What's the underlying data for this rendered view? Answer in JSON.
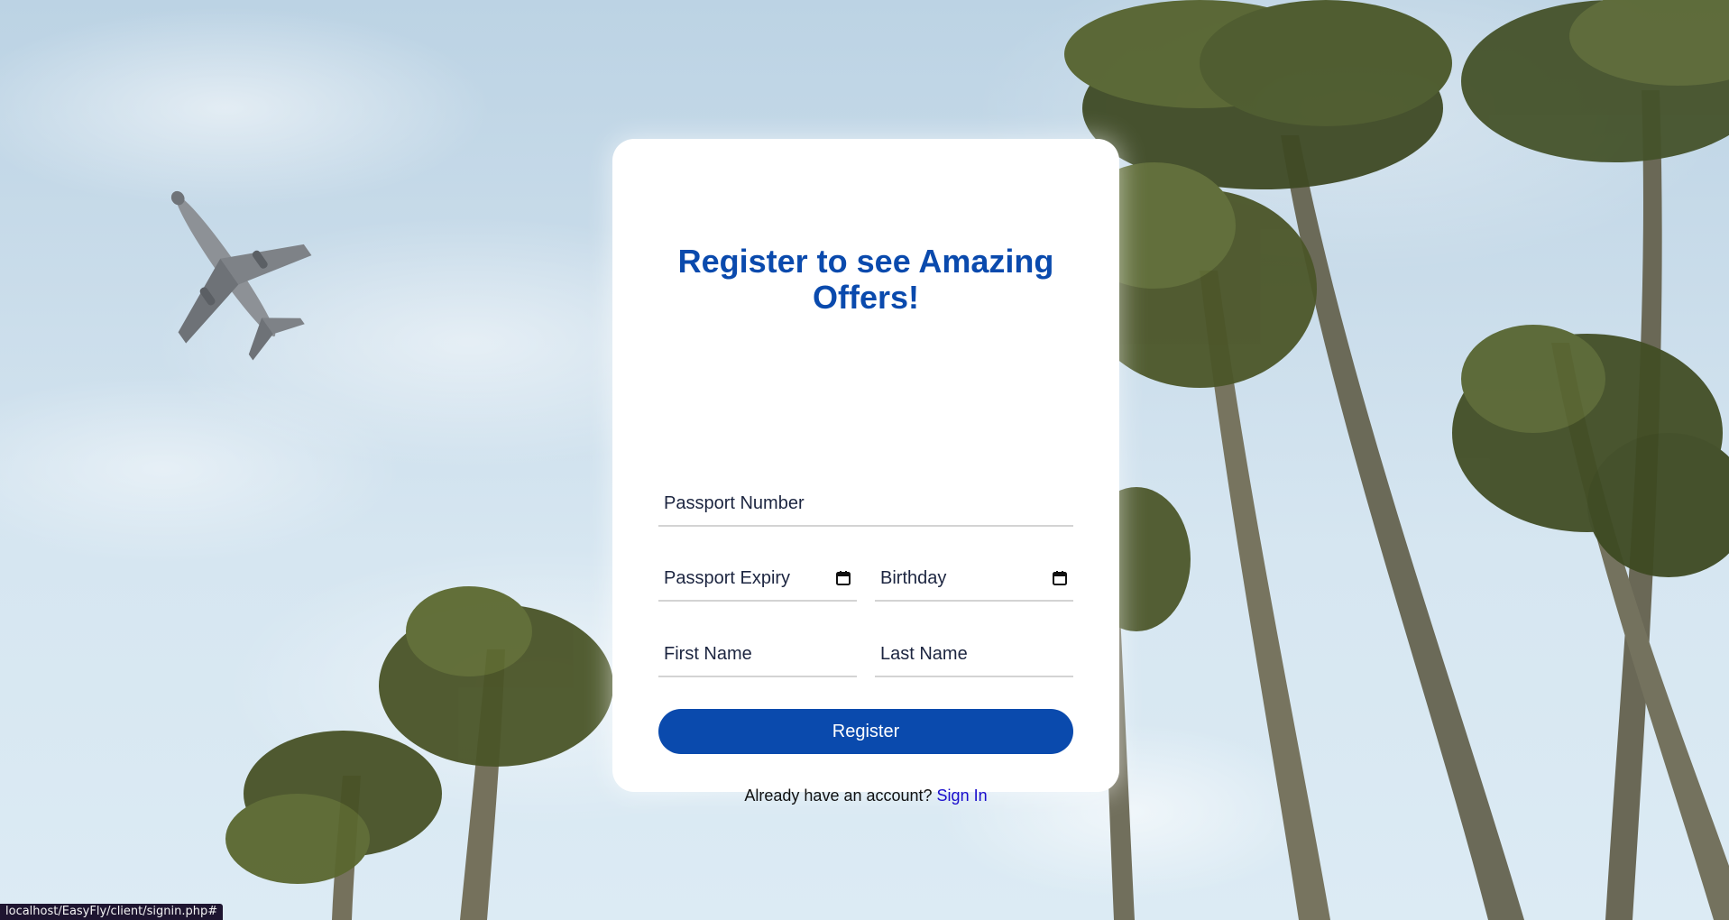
{
  "background": {
    "description_icons": [
      "airplane-illustration",
      "palm-trees-illustration"
    ]
  },
  "form": {
    "title": "Register to see Amazing Offers!",
    "passport_number_placeholder": "Passport Number",
    "passport_expiry_placeholder": "Passport Expiry",
    "birthday_placeholder": "Birthday",
    "first_name_placeholder": "First Name",
    "last_name_placeholder": "Last Name",
    "register_label": "Register",
    "signin_prompt": "Already have an account?",
    "signin_link_label": "Sign In"
  },
  "status_bar": {
    "url": "localhost/EasyFly/client/signin.php#"
  },
  "colors": {
    "accent": "#0a4aad",
    "link": "#1a0dcc",
    "card": "#ffffff"
  }
}
